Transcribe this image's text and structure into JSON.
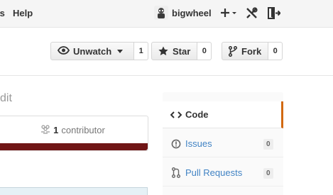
{
  "topbar": {
    "help_label": "Help",
    "username": "bigwheel"
  },
  "repo_actions": {
    "unwatch": {
      "label": "Unwatch",
      "count": "1"
    },
    "star": {
      "label": "Star",
      "count": "0"
    },
    "fork": {
      "label": "Fork",
      "count": "0"
    }
  },
  "main": {
    "edit_label": "dit",
    "contributors_count": "1",
    "contributors_label": "contributor",
    "language_bar_color": "#701516"
  },
  "sidenav": {
    "accent_color": "#d26911",
    "code_label": "Code",
    "issues_label": "Issues",
    "issues_count": "0",
    "pulls_label": "Pull Requests",
    "pulls_count": "0"
  }
}
